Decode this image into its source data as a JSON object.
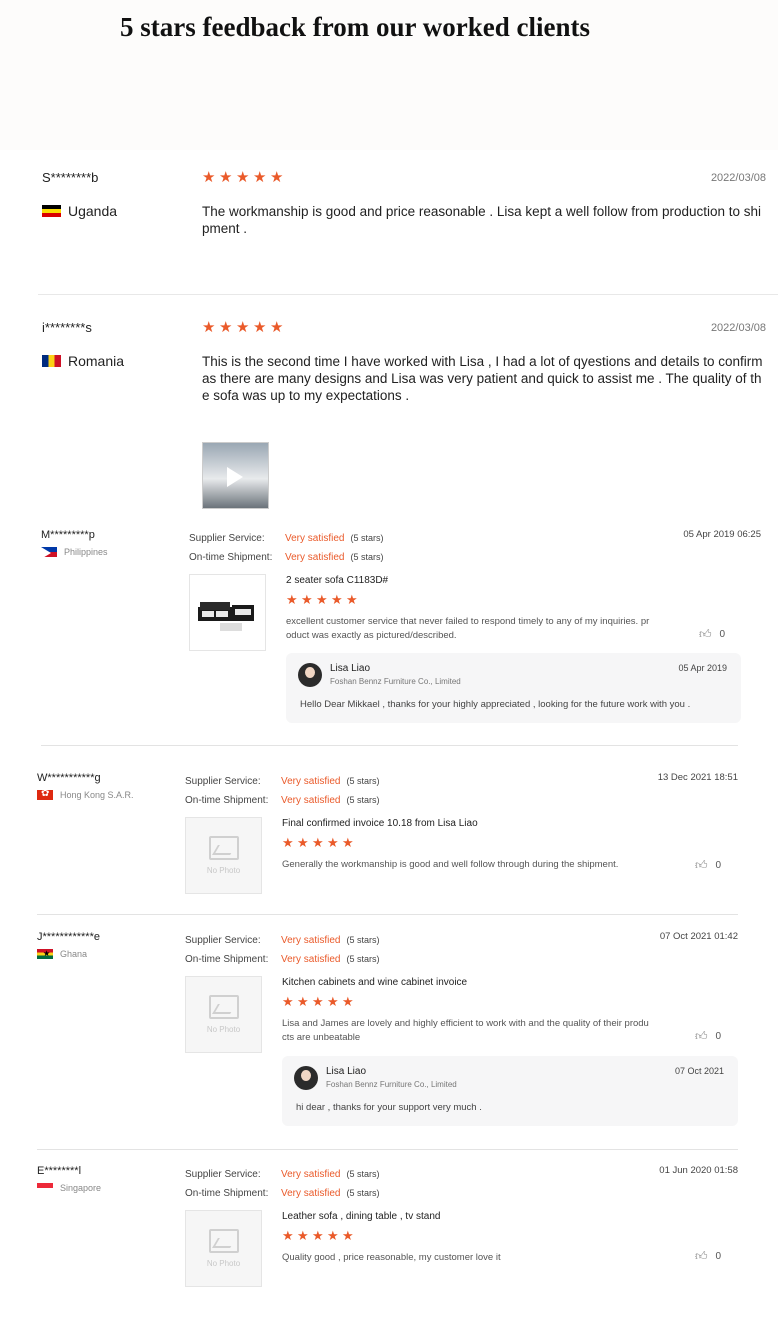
{
  "header": {
    "title": "5 stars feedback from our worked clients"
  },
  "colors": {
    "accent": "#ea5a2a"
  },
  "top_reviews": [
    {
      "user": "S********b",
      "country": "Uganda",
      "flag_icon": "uganda-flag-icon",
      "date": "2022/03/08",
      "text": "The workmanship is good and price reasonable . Lisa kept a well follow from production to shipment .",
      "rating": 5
    },
    {
      "user": "i********s",
      "country": "Romania",
      "flag_icon": "romania-flag-icon",
      "date": "2022/03/08",
      "text": "This is the second time I have worked with Lisa , I had a lot of qyestions and details to confirm as there are many designs and Lisa was very patient and quick to assist me . The quality of the sofa was up to my expectations .",
      "rating": 5,
      "has_video": true
    }
  ],
  "labels": {
    "supplier_service": "Supplier Service:",
    "ontime_shipment": "On-time Shipment:",
    "very_satisfied": "Very satisfied",
    "five_stars": "(5 stars)",
    "no_photo": "No Photo"
  },
  "reviews": [
    {
      "user": "M*********p",
      "country": "Philippines",
      "date": "05 Apr 2019 06:25",
      "product": "2 seater sofa C1183D#",
      "text": "excellent customer service that never failed to respond timely to any of my inquiries. product was exactly as pictured/described.",
      "likes": "0",
      "reply": {
        "name": "Lisa Liao",
        "company": "Foshan Bennz Furniture Co., Limited",
        "date": "05 Apr 2019",
        "text": "Hello Dear Mikkael , thanks for your highly appreciated ,  looking for the future work with you ."
      }
    },
    {
      "user": "W***********g",
      "country": "Hong Kong S.A.R.",
      "date": "13 Dec 2021 18:51",
      "product": "Final confirmed invoice 10.18 from Lisa Liao",
      "text": "Generally the workmanship is good and well follow through during the shipment.",
      "likes": "0"
    },
    {
      "user": "J************e",
      "country": "Ghana",
      "date": "07 Oct 2021 01:42",
      "product": "Kitchen cabinets and wine cabinet invoice",
      "text": "Lisa and James are lovely and highly efficient to work with and the quality of their products are unbeatable",
      "likes": "0",
      "reply": {
        "name": "Lisa Liao",
        "company": "Foshan Bennz Furniture Co., Limited",
        "date": "07 Oct 2021",
        "text": "hi dear , thanks for your support very much ."
      }
    },
    {
      "user": "E********l",
      "country": "Singapore",
      "date": "01 Jun 2020 01:58",
      "product": "Leather sofa , dining table , tv stand",
      "text": "Quality good , price reasonable, my customer love it",
      "likes": "0"
    }
  ]
}
